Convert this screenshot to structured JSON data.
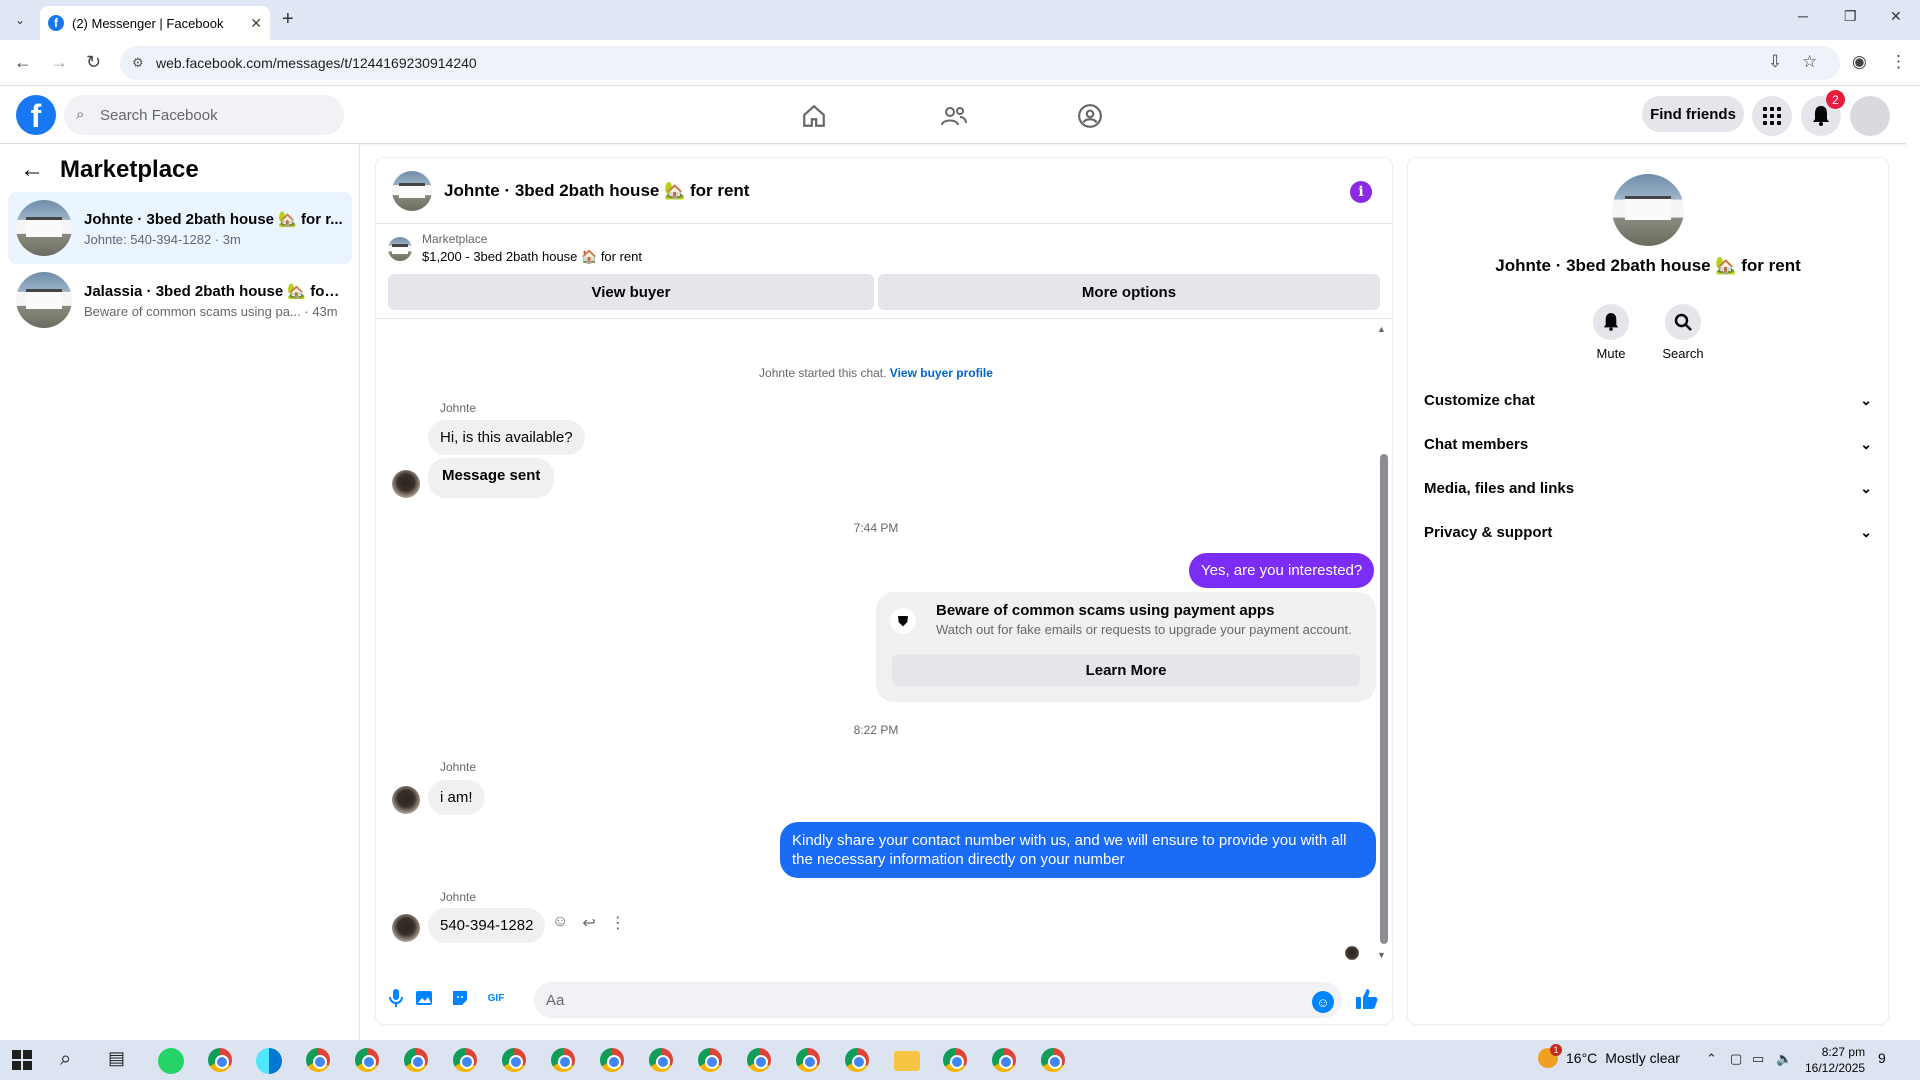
{
  "browser": {
    "tab_title": "(2) Messenger | Facebook",
    "tab_close": "✕",
    "new_tab": "+",
    "url": "web.facebook.com/messages/t/1244169230914240",
    "win_min": "─",
    "win_restore": "❐",
    "win_close": "✕"
  },
  "fb_header": {
    "logo": "f",
    "search_placeholder": "Search Facebook",
    "find_friends": "Find friends",
    "notification_count": "2"
  },
  "left_panel": {
    "title": "Marketplace",
    "conversations": [
      {
        "name": "Johnte · 3bed 2bath house 🏡 for r...",
        "preview": "Johnte: 540-394-1282 · 3m"
      },
      {
        "name": "Jalassia · 3bed 2bath house 🏡 for ...",
        "preview": "Beware of common scams using pa... · 43m"
      }
    ]
  },
  "chat": {
    "title": "Johnte · 3bed 2bath house 🏡 for rent",
    "listing_source": "Marketplace",
    "listing_desc": "$1,200 - 3bed 2bath house 🏠 for rent",
    "view_buyer": "View buyer",
    "more_options": "More options",
    "started_text": "Johnte started this chat.",
    "view_buyer_profile": "View buyer profile",
    "sender_name": "Johnte",
    "msg1": "Hi, is this available?",
    "msg2": "Message sent",
    "time1": "7:44 PM",
    "msg_out1": "Yes, are you interested?",
    "scam_title": "Beware of common scams using payment apps",
    "scam_sub": "Watch out for fake emails or requests to upgrade your payment account.",
    "learn_more": "Learn More",
    "time2": "8:22 PM",
    "msg3": "i am!",
    "msg_out2": "Kindly share your contact number with us, and we will ensure to provide you with all the necessary information directly on your number",
    "msg4": "540-394-1282",
    "composer_placeholder": "Aa",
    "gif_label": "GIF",
    "colors": {
      "purple_bubble": "#7b2cf5",
      "blue_bubble": "#1a6cf5"
    }
  },
  "right_panel": {
    "name": "Johnte · 3bed 2bath house 🏡 for rent",
    "mute": "Mute",
    "search": "Search",
    "sections": [
      "Customize chat",
      "Chat members",
      "Media, files and links",
      "Privacy & support"
    ]
  },
  "taskbar": {
    "temperature": "16°C",
    "weather": "Mostly clear",
    "weather_badge": "1",
    "time": "8:27 pm",
    "date": "16/12/2025",
    "notif_count": "9"
  }
}
